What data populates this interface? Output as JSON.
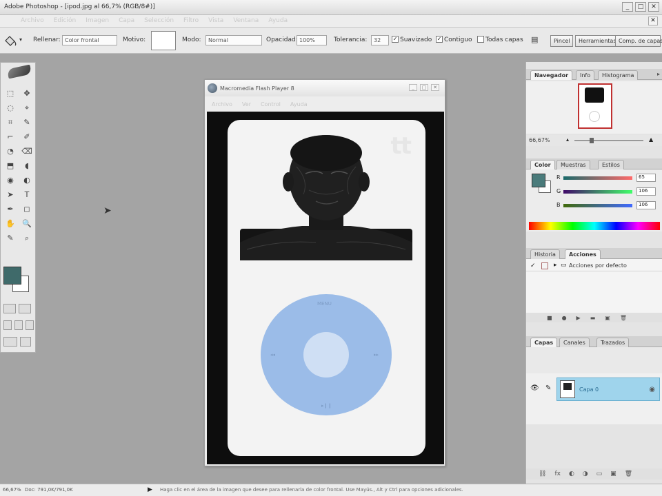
{
  "app": {
    "title": "Adobe Photoshop - [ipod.jpg al 66,7% (RGB/8#)]",
    "window_buttons": [
      "_",
      "□",
      "✕"
    ],
    "menus": [
      "Archivo",
      "Edición",
      "Imagen",
      "Capa",
      "Selección",
      "Filtro",
      "Vista",
      "Ventana",
      "Ayuda"
    ],
    "doc_close": "✕"
  },
  "options_bar": {
    "tool_icon": "paint-bucket-icon",
    "fill_label": "Rellenar:",
    "fill_value": "Color frontal",
    "pattern_label": "Motivo:",
    "mode_label": "Modo:",
    "mode_value": "Normal",
    "opacity_label": "Opacidad:",
    "opacity_value": "100%",
    "tolerance_label": "Tolerancia:",
    "tolerance_value": "32",
    "antialias_label": "Suavizado",
    "contiguous_label": "Contiguo",
    "all_layers_label": "Todas capas",
    "panel_buttons": [
      "Pincel",
      "Herramientas",
      "Comp. de capas"
    ]
  },
  "toolbox": {
    "tools": [
      "⬚",
      "✥",
      "◌",
      "⌖",
      "⌗",
      "✎",
      "⌐",
      "✐",
      "◔",
      "⌫",
      "⬒",
      "◖",
      "◉",
      "◐",
      "➤",
      "T",
      "✒",
      "◻",
      "✋",
      "🔍",
      "✎",
      "⌕"
    ],
    "foreground_color": "#3f6a6a",
    "background_color": "#ffffff"
  },
  "document": {
    "title": "Macromedia Flash Player 8",
    "menus": [
      "Archivo",
      "Ver",
      "Control",
      "Ayuda"
    ],
    "controls": [
      "_",
      "□",
      "✕"
    ],
    "brand_watermark": "tt",
    "wheel_labels": {
      "top": "MENU",
      "left": "◂◂",
      "right": "▸▸",
      "bottom": "▸❙❙"
    }
  },
  "panels": {
    "navigator": {
      "tabs": [
        "Navegador",
        "Info",
        "Histograma"
      ],
      "zoom": "66,67%",
      "menu": "▸"
    },
    "color": {
      "tabs": [
        "Color",
        "Muestras",
        "Estilos"
      ],
      "r_label": "R",
      "g_label": "G",
      "b_label": "B",
      "r_value": "65",
      "g_value": "106",
      "b_value": "106"
    },
    "actions": {
      "tabs": [
        "Historia",
        "Acciones"
      ],
      "row_label": "Acciones por defecto",
      "footer": [
        "■",
        "●",
        "▶",
        "▬",
        "▣",
        "🗑"
      ]
    },
    "layers": {
      "tabs": [
        "Capas",
        "Canales",
        "Trazados"
      ],
      "layer_name": "Capa 0",
      "footer": [
        "⛓",
        "fx",
        "◐",
        "◑",
        "▭",
        "▣",
        "🗑"
      ]
    }
  },
  "status_bar": {
    "zoom": "66,67%",
    "doc_size": "Doc: 791,0K/791,0K",
    "arrow": "▶",
    "hint": "Haga clic en el área de la imagen que desee para rellenarla de color frontal. Use Mayús., Alt y Ctrl para opciones adicionales."
  }
}
